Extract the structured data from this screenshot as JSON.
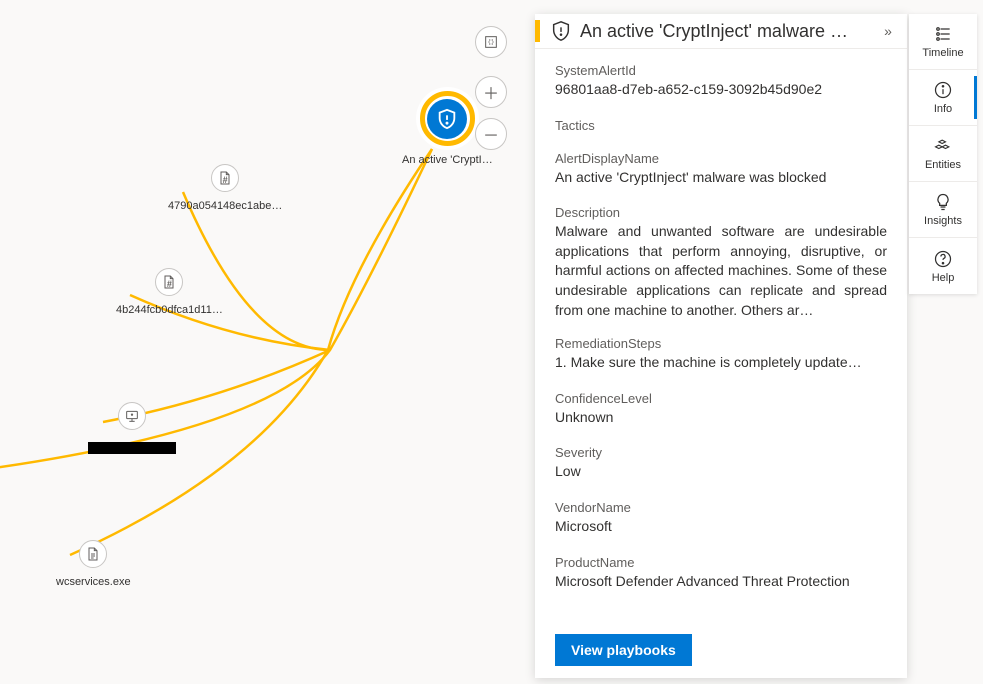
{
  "alert_node": {
    "label": "An active 'CryptI…"
  },
  "nodes": {
    "hash1": "4790a054148ec1abe…",
    "hash2": "4b244fcb0dfca1d11…",
    "exe": "wcservices.exe"
  },
  "panel": {
    "title": "An active 'CryptInject' malware …",
    "fields": {
      "SystemAlertId": {
        "label": "SystemAlertId",
        "value": "96801aa8-d7eb-a652-c159-3092b45d90e2"
      },
      "Tactics": {
        "label": "Tactics",
        "value": ""
      },
      "AlertDisplayName": {
        "label": "AlertDisplayName",
        "value": "An active 'CryptInject' malware was blocked"
      },
      "Description": {
        "label": "Description",
        "value": "Malware and unwanted software are undesirable applications that perform annoying, disruptive, or harmful actions on affected machines. Some of these undesirable applications can replicate and spread from one machine to another. Others ar…"
      },
      "RemediationSteps": {
        "label": "RemediationSteps",
        "value": "1. Make sure the machine is completely update…"
      },
      "ConfidenceLevel": {
        "label": "ConfidenceLevel",
        "value": "Unknown"
      },
      "Severity": {
        "label": "Severity",
        "value": "Low"
      },
      "VendorName": {
        "label": "VendorName",
        "value": "Microsoft"
      },
      "ProductName": {
        "label": "ProductName",
        "value": "Microsoft Defender Advanced Threat Protection"
      }
    },
    "button": "View playbooks"
  },
  "sidetabs": {
    "timeline": "Timeline",
    "info": "Info",
    "entities": "Entities",
    "insights": "Insights",
    "help": "Help"
  },
  "glyphs": {
    "collapse": "»",
    "zoom_in": "＋",
    "zoom_out": "－"
  }
}
